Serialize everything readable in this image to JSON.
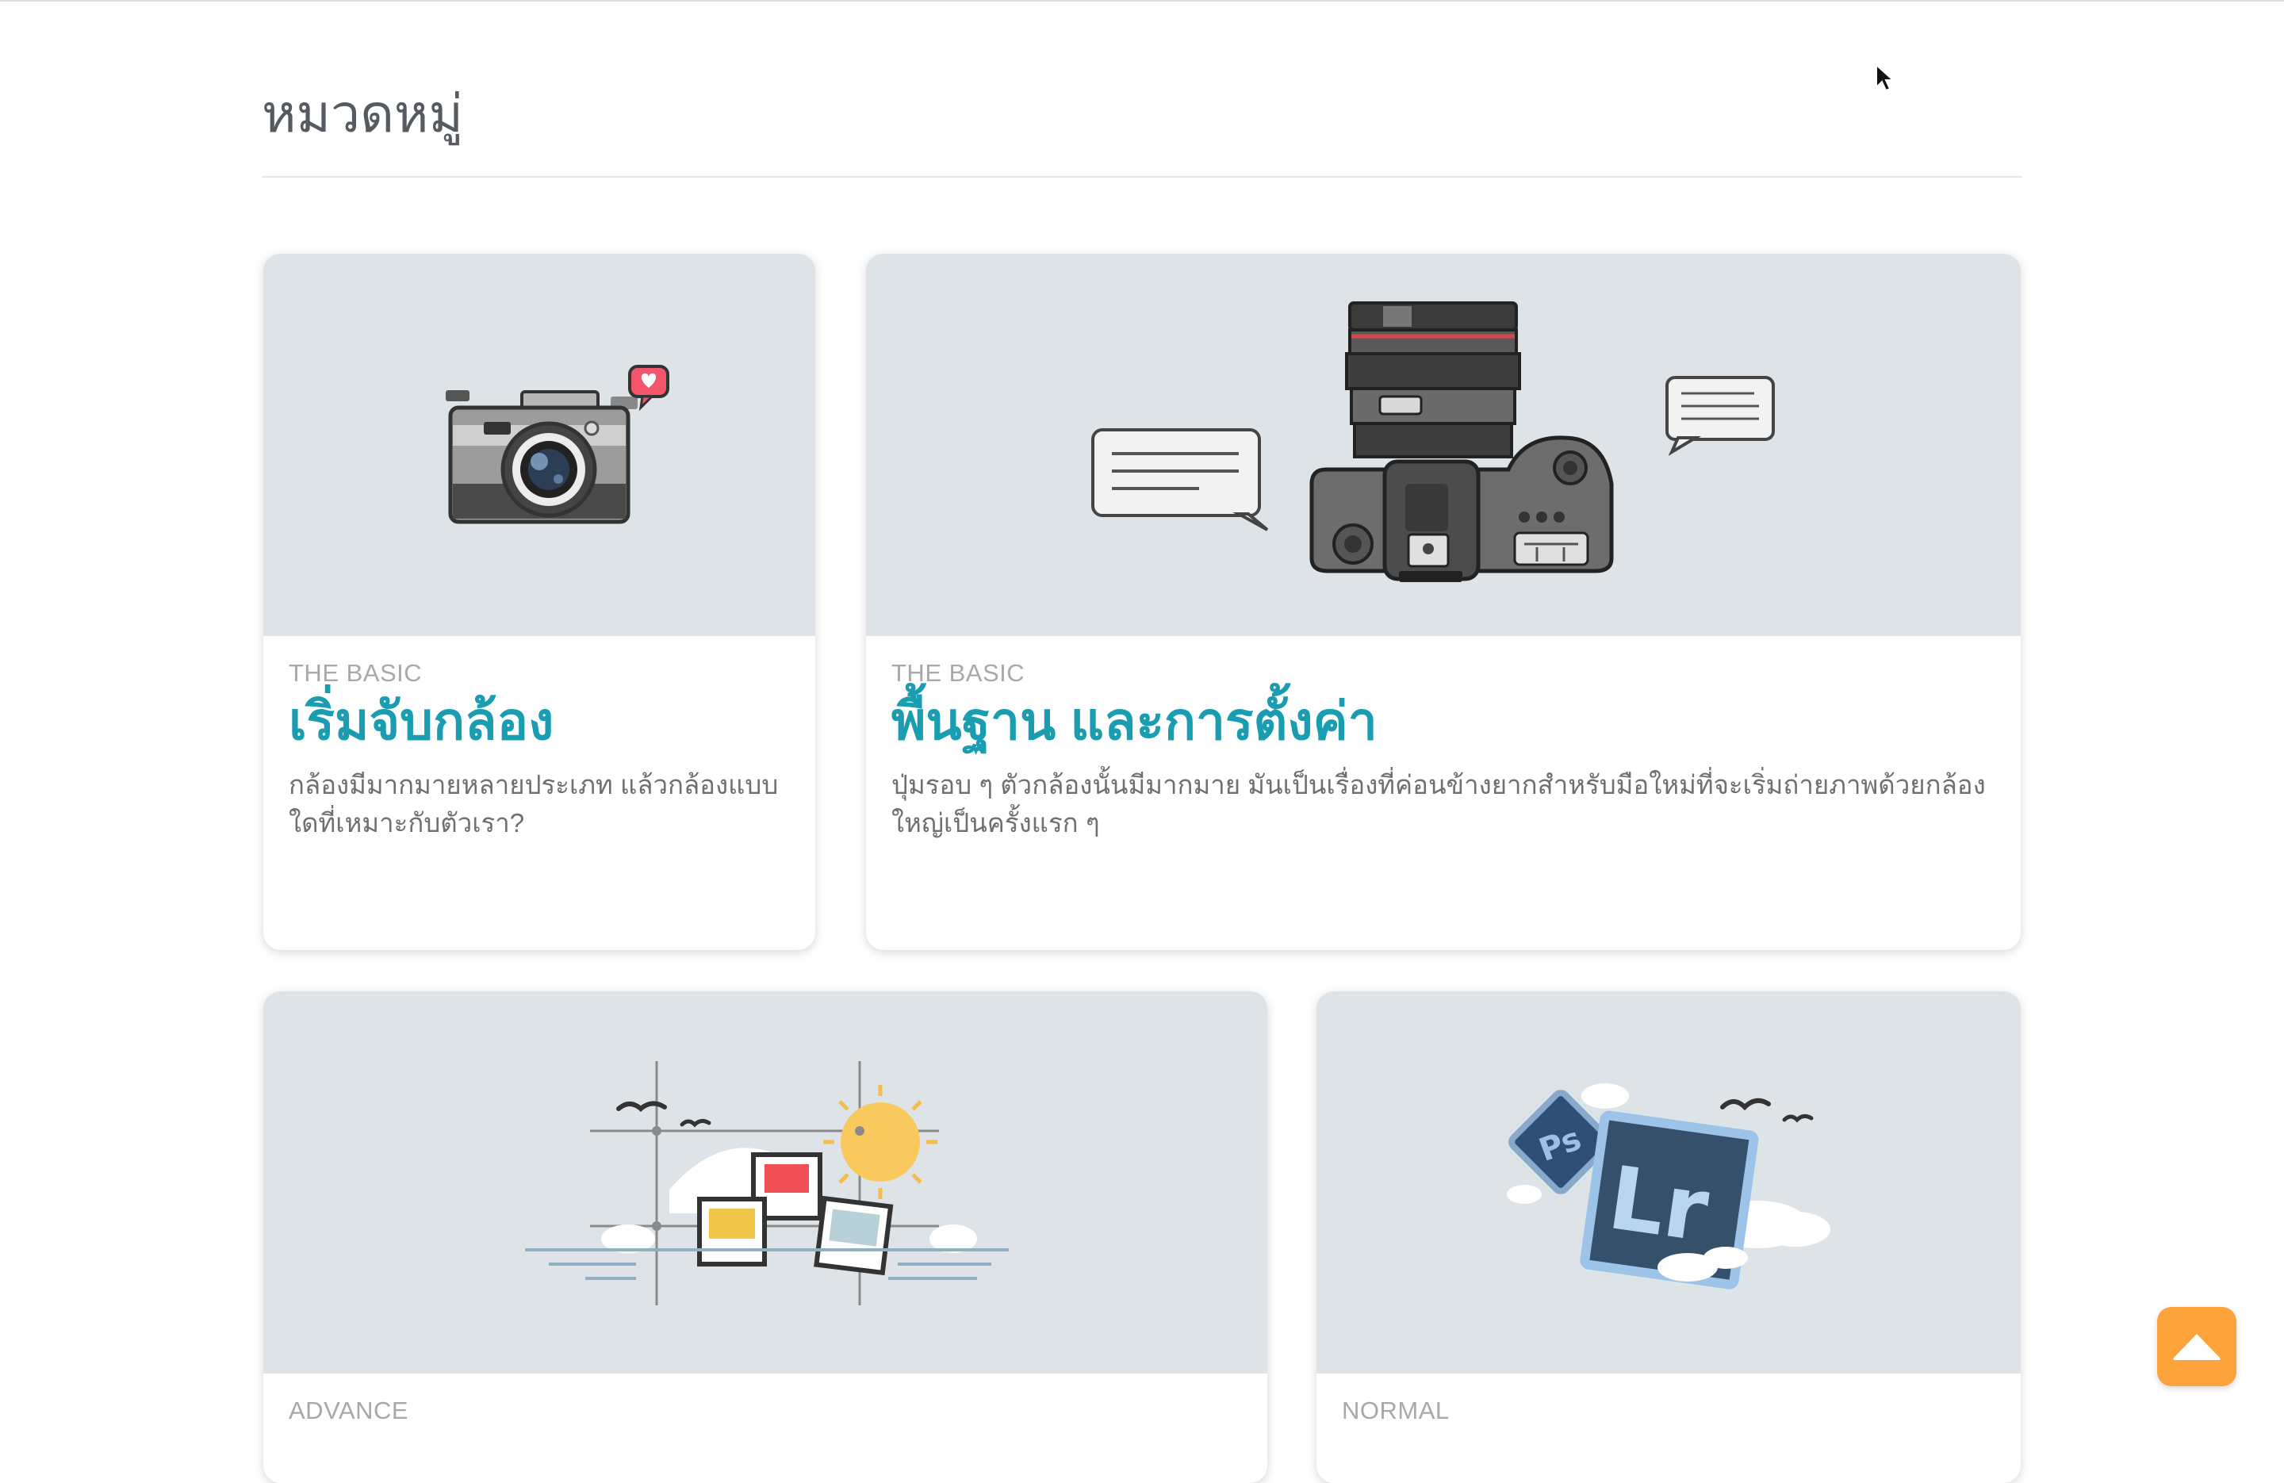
{
  "page": {
    "section_title": "หมวดหมู่"
  },
  "cards": [
    {
      "category": "THE BASIC",
      "title": "เริ่มจับกล้อง",
      "description": "กล้องมีมากมายหลายประเภท แล้วกล้องแบบใดที่เหมาะกับตัวเรา?",
      "illustration": "camera-icon"
    },
    {
      "category": "THE BASIC",
      "title": "พื้นฐาน และการตั้งค่า",
      "description": "ปุ่มรอบ ๆ ตัวกล้องนั้นมีมากมาย มันเป็นเรื่องที่ค่อนข้างยากสำหรับมือใหม่ที่จะเริ่มถ่ายภาพด้วยกล้องใหญ่เป็นครั้งแรก ๆ",
      "illustration": "dslr-camera-icon"
    },
    {
      "category": "ADVANCE",
      "illustration": "composition-icon"
    },
    {
      "category": "NORMAL",
      "illustration": "photoshop-lightroom-icon"
    }
  ],
  "colors": {
    "accent": "#1a9db0",
    "card_image_bg": "#dde3e6",
    "scroll_button": "#fca33b"
  },
  "scroll_button": {
    "icon": "arrow-up-icon"
  }
}
